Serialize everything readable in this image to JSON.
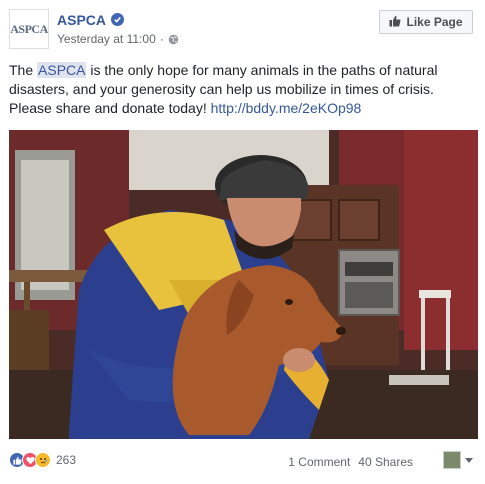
{
  "header": {
    "avatar_brand": "ASPCA",
    "page_name": "ASPCA",
    "timestamp": "Yesterday at 11:00",
    "separator": "·",
    "like_button_label": "Like Page"
  },
  "post": {
    "text_before": "The ",
    "mention": "ASPCA",
    "text_after": " is the only hope for many animals in the paths of natural disasters, and your generosity can help us mobilize in times of crisis. Please share and donate today! ",
    "link": "http://bddy.me/2eKOp98"
  },
  "photo": {
    "description_icon": "rescuer-holding-dog-photo"
  },
  "footer": {
    "reaction_count": "263",
    "comments": "1 Comment",
    "shares": "40 Shares"
  },
  "colors": {
    "brand_blue": "#365899",
    "like_blue": "#4267b2",
    "love_red": "#f25268",
    "sad_yellow": "#f7b928"
  }
}
